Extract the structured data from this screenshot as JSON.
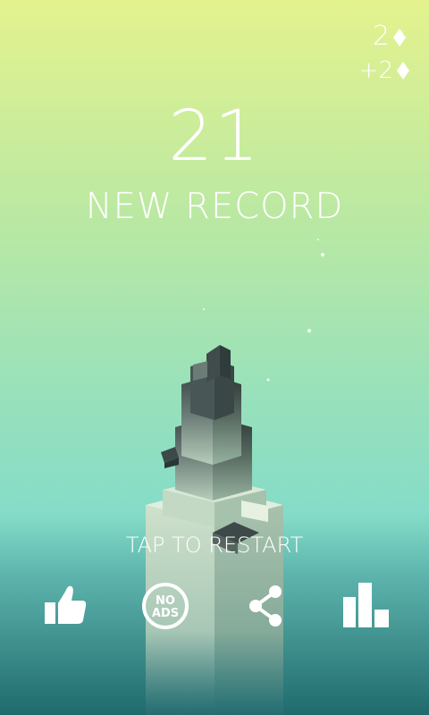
{
  "hud": {
    "gems": "2",
    "gems_earned": "+2"
  },
  "result": {
    "score": "21",
    "banner": "NEW RECORD",
    "restart_prompt": "TAP TO RESTART"
  },
  "buttons": {
    "like_icon": "thumbs-up-icon",
    "noads_text_top": "NO",
    "noads_text_bottom": "ADS",
    "share_icon": "share-icon",
    "leaderboard_icon": "leaderboard-icon"
  },
  "colors": {
    "sky_top": "#e3f08f",
    "sky_mid": "#a6e3ad",
    "sky_low": "#84dcc8",
    "water": "#2d7d7f",
    "tower_dark": "#3c4c4a",
    "tower_light": "#cfe0cb"
  }
}
